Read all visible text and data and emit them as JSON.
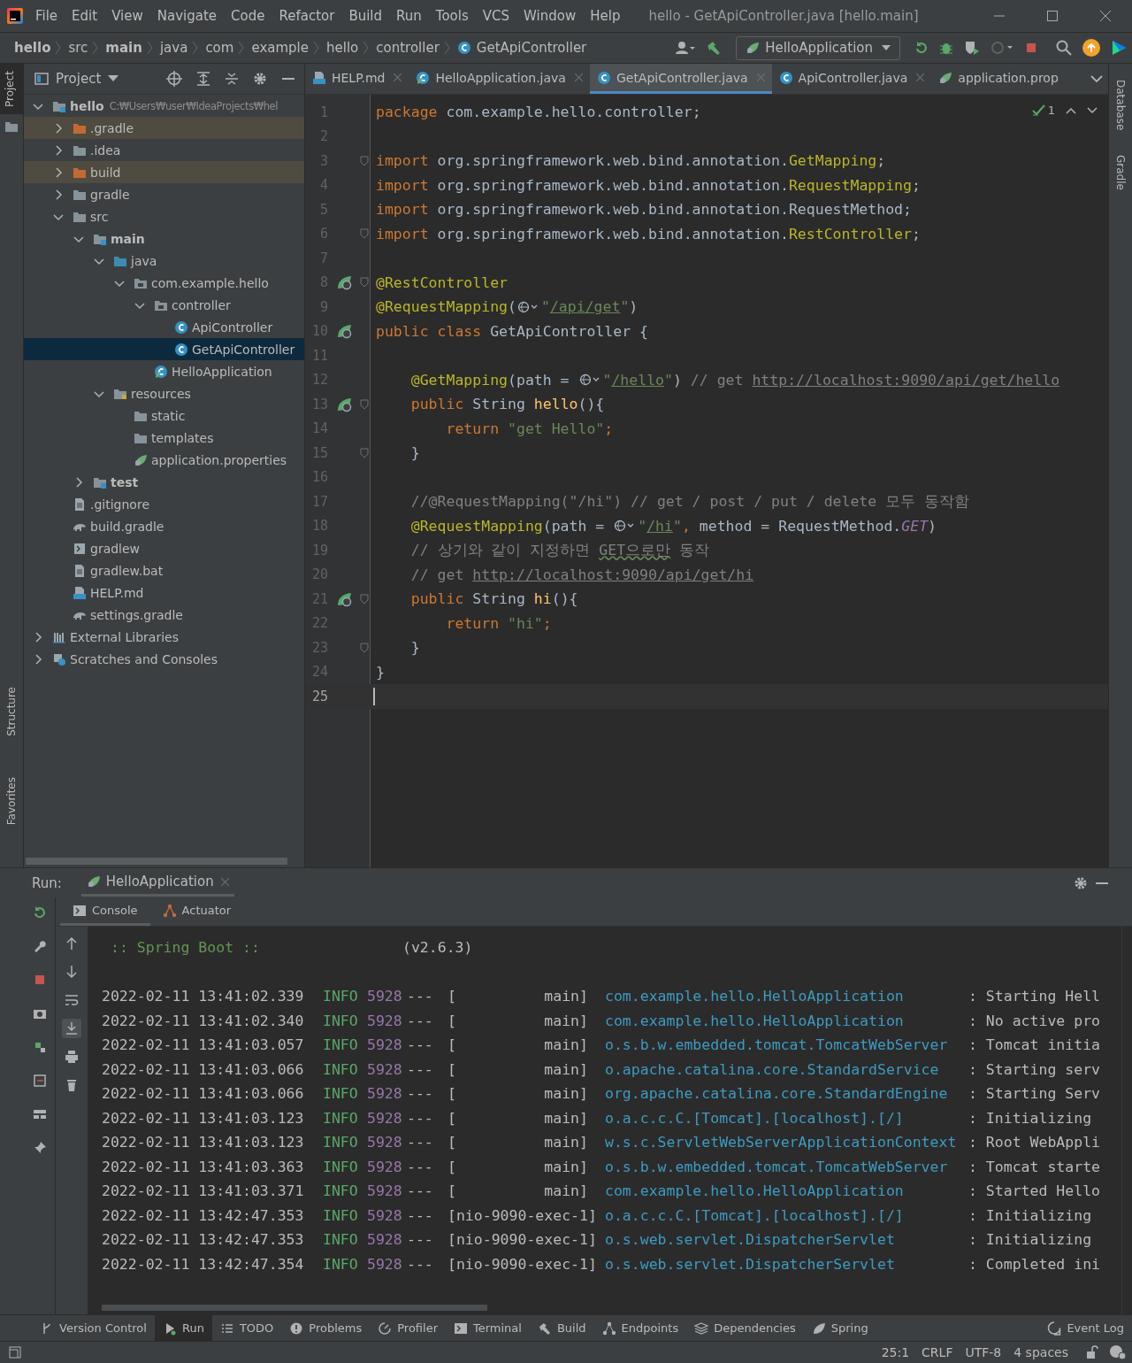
{
  "menu_bar": {
    "items": [
      "File",
      "Edit",
      "View",
      "Navigate",
      "Code",
      "Refactor",
      "Build",
      "Run",
      "Tools",
      "VCS",
      "Window",
      "Help"
    ],
    "title": "hello - GetApiController.java [hello.main]"
  },
  "breadcrumbs": [
    {
      "label": "hello",
      "kind": "bold"
    },
    {
      "label": "src",
      "kind": "plain"
    },
    {
      "label": "main",
      "kind": "bold"
    },
    {
      "label": "java",
      "kind": "plain"
    },
    {
      "label": "com",
      "kind": "plain"
    },
    {
      "label": "example",
      "kind": "plain"
    },
    {
      "label": "hello",
      "kind": "plain"
    },
    {
      "label": "controller",
      "kind": "plain"
    },
    {
      "label": "GetApiController",
      "kind": "class"
    }
  ],
  "run_config": "HelloApplication",
  "left_strip": {
    "top": "Project",
    "bottom": [
      "Structure",
      "Favorites"
    ]
  },
  "right_strip": [
    "Database",
    "Gradle"
  ],
  "project_panel": {
    "title": "Project",
    "tree": [
      {
        "label": "hello",
        "path": "C:₩Users₩user₩IdeaProjects₩hel",
        "kind": "module",
        "selected": false,
        "expanded": true,
        "children": [
          {
            "label": ".gradle",
            "kind": "excluded-folder",
            "selected": false,
            "expanded": false
          },
          {
            "label": ".idea",
            "kind": "folder",
            "selected": false,
            "expanded": false
          },
          {
            "label": "build",
            "kind": "excluded-folder",
            "selected": false,
            "expanded": false
          },
          {
            "label": "gradle",
            "kind": "folder",
            "selected": false,
            "expanded": false
          },
          {
            "label": "src",
            "kind": "folder",
            "selected": false,
            "expanded": true,
            "children": [
              {
                "label": "main",
                "kind": "source-root",
                "selected": false,
                "expanded": true,
                "children": [
                  {
                    "label": "java",
                    "kind": "java-root",
                    "selected": false,
                    "expanded": true,
                    "children": [
                      {
                        "label": "com.example.hello",
                        "kind": "package",
                        "selected": false,
                        "expanded": true,
                        "children": [
                          {
                            "label": "controller",
                            "kind": "package",
                            "selected": false,
                            "expanded": true,
                            "children": [
                              {
                                "label": "ApiController",
                                "kind": "class",
                                "selected": false
                              },
                              {
                                "label": "GetApiController",
                                "kind": "class",
                                "selected": true
                              }
                            ]
                          },
                          {
                            "label": "HelloApplication",
                            "kind": "spring-class",
                            "selected": false
                          }
                        ]
                      }
                    ]
                  },
                  {
                    "label": "resources",
                    "kind": "resources-folder",
                    "selected": false,
                    "expanded": true,
                    "children": [
                      {
                        "label": "static",
                        "kind": "folder",
                        "selected": false
                      },
                      {
                        "label": "templates",
                        "kind": "folder",
                        "selected": false
                      },
                      {
                        "label": "application.properties",
                        "kind": "spring-file",
                        "selected": false
                      }
                    ]
                  }
                ]
              },
              {
                "label": "test",
                "kind": "source-root",
                "selected": false,
                "expanded": false
              }
            ]
          },
          {
            "label": ".gitignore",
            "kind": "text-file",
            "selected": false
          },
          {
            "label": "build.gradle",
            "kind": "gradle-file",
            "selected": false
          },
          {
            "label": "gradlew",
            "kind": "script-file",
            "selected": false
          },
          {
            "label": "gradlew.bat",
            "kind": "text-file",
            "selected": false
          },
          {
            "label": "HELP.md",
            "kind": "md-file",
            "selected": false
          },
          {
            "label": "settings.gradle",
            "kind": "gradle-file",
            "selected": false
          }
        ]
      },
      {
        "label": "External Libraries",
        "kind": "libraries",
        "selected": false,
        "expanded": false
      },
      {
        "label": "Scratches and Consoles",
        "kind": "scratches",
        "selected": false,
        "expanded": false
      }
    ]
  },
  "editor_tabs": [
    {
      "label": "HELP.md",
      "kind": "md-file",
      "selected": false
    },
    {
      "label": "HelloApplication.java",
      "kind": "spring-class",
      "selected": false
    },
    {
      "label": "GetApiController.java",
      "kind": "class",
      "selected": true
    },
    {
      "label": "ApiController.java",
      "kind": "class",
      "selected": false
    },
    {
      "label": "application.prop",
      "kind": "spring-file",
      "selected": false
    }
  ],
  "inspection_count": "1",
  "code_lines": [
    {
      "number": "1",
      "current": false,
      "bean": false,
      "fold": false,
      "tokens": [
        {
          "kind": "keyword",
          "text": "package"
        },
        {
          "kind": "plain",
          "text": " com.example.hello.controller;"
        }
      ]
    },
    {
      "number": "2",
      "current": false,
      "bean": false,
      "fold": false
    },
    {
      "number": "3",
      "current": false,
      "bean": false,
      "fold": true,
      "tokens": [
        {
          "kind": "keyword",
          "text": "import"
        },
        {
          "kind": "plain",
          "text": " org.springframework.web.bind.annotation."
        },
        {
          "kind": "annotation",
          "text": "GetMapping"
        },
        {
          "kind": "plain",
          "text": ";"
        }
      ]
    },
    {
      "number": "4",
      "current": false,
      "bean": false,
      "fold": false,
      "tokens": [
        {
          "kind": "keyword",
          "text": "import"
        },
        {
          "kind": "plain",
          "text": " org.springframework.web.bind.annotation."
        },
        {
          "kind": "annotation",
          "text": "RequestMapping"
        },
        {
          "kind": "plain",
          "text": ";"
        }
      ]
    },
    {
      "number": "5",
      "current": false,
      "bean": false,
      "fold": false,
      "tokens": [
        {
          "kind": "keyword",
          "text": "import"
        },
        {
          "kind": "plain",
          "text": " org.springframework.web.bind.annotation.RequestMethod;"
        }
      ]
    },
    {
      "number": "6",
      "current": false,
      "bean": false,
      "fold": true,
      "tokens": [
        {
          "kind": "keyword",
          "text": "import"
        },
        {
          "kind": "plain",
          "text": " org.springframework.web.bind.annotation."
        },
        {
          "kind": "annotation",
          "text": "RestController"
        },
        {
          "kind": "plain",
          "text": ";"
        }
      ]
    },
    {
      "number": "7",
      "current": false,
      "bean": false,
      "fold": false
    },
    {
      "number": "8",
      "current": false,
      "bean": true,
      "fold": true,
      "tokens": [
        {
          "kind": "annotation",
          "text": "@RestController"
        }
      ]
    },
    {
      "number": "9",
      "current": false,
      "bean": false,
      "fold": false,
      "tokens": [
        {
          "kind": "annotation",
          "text": "@RequestMapping"
        },
        {
          "kind": "plain",
          "text": "("
        },
        {
          "kind": "globe"
        },
        {
          "kind": "string",
          "text": "\""
        },
        {
          "kind": "string-link",
          "text": "/api/get"
        },
        {
          "kind": "string",
          "text": "\""
        },
        {
          "kind": "plain",
          "text": ")"
        }
      ]
    },
    {
      "number": "10",
      "current": false,
      "bean": true,
      "fold": false,
      "tokens": [
        {
          "kind": "keyword",
          "text": "public class"
        },
        {
          "kind": "plain",
          "text": " GetApiController {"
        }
      ]
    },
    {
      "number": "11",
      "current": false,
      "bean": false,
      "fold": false
    },
    {
      "number": "12",
      "current": false,
      "bean": false,
      "fold": false,
      "tokens": [
        {
          "kind": "annotation",
          "text": "    @GetMapping"
        },
        {
          "kind": "plain",
          "text": "(path = "
        },
        {
          "kind": "globe"
        },
        {
          "kind": "string",
          "text": "\""
        },
        {
          "kind": "string-link",
          "text": "/hello"
        },
        {
          "kind": "string",
          "text": "\""
        },
        {
          "kind": "plain",
          "text": ") "
        },
        {
          "kind": "comment",
          "text": "// get "
        },
        {
          "kind": "comment-link",
          "text": "http://localhost:9090/api/get/hello"
        }
      ]
    },
    {
      "number": "13",
      "current": false,
      "bean": true,
      "fold": true,
      "tokens": [
        {
          "kind": "keyword",
          "text": "    public"
        },
        {
          "kind": "plain",
          "text": " String "
        },
        {
          "kind": "method",
          "text": "hello"
        },
        {
          "kind": "plain",
          "text": "(){"
        }
      ]
    },
    {
      "number": "14",
      "current": false,
      "bean": false,
      "fold": false,
      "tokens": [
        {
          "kind": "keyword",
          "text": "        return"
        },
        {
          "kind": "string",
          "text": " \"get Hello\""
        },
        {
          "kind": "keyword",
          "text": ";"
        }
      ]
    },
    {
      "number": "15",
      "current": false,
      "bean": false,
      "fold": true,
      "tokens": [
        {
          "kind": "plain",
          "text": "    }"
        }
      ]
    },
    {
      "number": "16",
      "current": false,
      "bean": false,
      "fold": false
    },
    {
      "number": "17",
      "current": false,
      "bean": false,
      "fold": false,
      "tokens": [
        {
          "kind": "comment",
          "text": "    //@RequestMapping(\"/hi\") // get / post / put / delete 모두 동작함"
        }
      ]
    },
    {
      "number": "18",
      "current": false,
      "bean": false,
      "fold": false,
      "tokens": [
        {
          "kind": "annotation",
          "text": "    @RequestMapping"
        },
        {
          "kind": "plain",
          "text": "(path = "
        },
        {
          "kind": "globe"
        },
        {
          "kind": "string",
          "text": "\""
        },
        {
          "kind": "string-link",
          "text": "/hi"
        },
        {
          "kind": "string",
          "text": "\""
        },
        {
          "kind": "keyword",
          "text": ","
        },
        {
          "kind": "plain",
          "text": " method = RequestMethod."
        },
        {
          "kind": "constant",
          "text": "GET"
        },
        {
          "kind": "plain",
          "text": ")"
        }
      ]
    },
    {
      "number": "19",
      "current": false,
      "bean": false,
      "fold": false,
      "tokens": [
        {
          "kind": "comment",
          "text": "    // 상기와 같이 지정하면 "
        },
        {
          "kind": "comment-typo",
          "text": "GET으로만"
        },
        {
          "kind": "comment",
          "text": " 동작"
        }
      ]
    },
    {
      "number": "20",
      "current": false,
      "bean": false,
      "fold": false,
      "tokens": [
        {
          "kind": "comment",
          "text": "    // get "
        },
        {
          "kind": "comment-link",
          "text": "http://localhost:9090/api/get/hi"
        }
      ]
    },
    {
      "number": "21",
      "current": false,
      "bean": true,
      "fold": true,
      "tokens": [
        {
          "kind": "keyword",
          "text": "    public"
        },
        {
          "kind": "plain",
          "text": " String "
        },
        {
          "kind": "method",
          "text": "hi"
        },
        {
          "kind": "plain",
          "text": "(){"
        }
      ]
    },
    {
      "number": "22",
      "current": false,
      "bean": false,
      "fold": false,
      "tokens": [
        {
          "kind": "keyword",
          "text": "        return"
        },
        {
          "kind": "string",
          "text": " \"hi\""
        },
        {
          "kind": "keyword",
          "text": ";"
        }
      ]
    },
    {
      "number": "23",
      "current": false,
      "bean": false,
      "fold": true,
      "tokens": [
        {
          "kind": "plain",
          "text": "    }"
        }
      ]
    },
    {
      "number": "24",
      "current": false,
      "bean": false,
      "fold": false,
      "tokens": [
        {
          "kind": "plain",
          "text": "}"
        }
      ]
    },
    {
      "number": "25",
      "current": true,
      "bean": false,
      "fold": false
    }
  ],
  "run_panel": {
    "label": "Run:",
    "tab": "HelloApplication",
    "subtabs": [
      {
        "label": "Console",
        "kind": "console",
        "selected": true
      },
      {
        "label": "Actuator",
        "kind": "actuator",
        "selected": false
      }
    ],
    "banner": {
      "name": ":: Spring Boot ::",
      "version": "(v2.6.3)"
    },
    "log": [
      {
        "time": "2022-02-11 13:41:02.339",
        "level": "INFO",
        "pid": "5928",
        "sep": "---",
        "thread": "[          main]",
        "logger": "com.example.hello.HelloApplication",
        "message": ": Starting Hell"
      },
      {
        "time": "2022-02-11 13:41:02.340",
        "level": "INFO",
        "pid": "5928",
        "sep": "---",
        "thread": "[          main]",
        "logger": "com.example.hello.HelloApplication",
        "message": ": No active pro"
      },
      {
        "time": "2022-02-11 13:41:03.057",
        "level": "INFO",
        "pid": "5928",
        "sep": "---",
        "thread": "[          main]",
        "logger": "o.s.b.w.embedded.tomcat.TomcatWebServer",
        "message": ": Tomcat initia"
      },
      {
        "time": "2022-02-11 13:41:03.066",
        "level": "INFO",
        "pid": "5928",
        "sep": "---",
        "thread": "[          main]",
        "logger": "o.apache.catalina.core.StandardService",
        "message": ": Starting serv"
      },
      {
        "time": "2022-02-11 13:41:03.066",
        "level": "INFO",
        "pid": "5928",
        "sep": "---",
        "thread": "[          main]",
        "logger": "org.apache.catalina.core.StandardEngine",
        "message": ": Starting Serv"
      },
      {
        "time": "2022-02-11 13:41:03.123",
        "level": "INFO",
        "pid": "5928",
        "sep": "---",
        "thread": "[          main]",
        "logger": "o.a.c.c.C.[Tomcat].[localhost].[/]",
        "message": ": Initializing"
      },
      {
        "time": "2022-02-11 13:41:03.123",
        "level": "INFO",
        "pid": "5928",
        "sep": "---",
        "thread": "[          main]",
        "logger": "w.s.c.ServletWebServerApplicationContext",
        "message": ": Root WebAppli"
      },
      {
        "time": "2022-02-11 13:41:03.363",
        "level": "INFO",
        "pid": "5928",
        "sep": "---",
        "thread": "[          main]",
        "logger": "o.s.b.w.embedded.tomcat.TomcatWebServer",
        "message": ": Tomcat starte"
      },
      {
        "time": "2022-02-11 13:41:03.371",
        "level": "INFO",
        "pid": "5928",
        "sep": "---",
        "thread": "[          main]",
        "logger": "com.example.hello.HelloApplication",
        "message": ": Started Hello"
      },
      {
        "time": "2022-02-11 13:42:47.353",
        "level": "INFO",
        "pid": "5928",
        "sep": "---",
        "thread": "[nio-9090-exec-1]",
        "logger": "o.a.c.c.C.[Tomcat].[localhost].[/]",
        "message": ": Initializing"
      },
      {
        "time": "2022-02-11 13:42:47.353",
        "level": "INFO",
        "pid": "5928",
        "sep": "---",
        "thread": "[nio-9090-exec-1]",
        "logger": "o.s.web.servlet.DispatcherServlet",
        "message": ": Initializing"
      },
      {
        "time": "2022-02-11 13:42:47.354",
        "level": "INFO",
        "pid": "5928",
        "sep": "---",
        "thread": "[nio-9090-exec-1]",
        "logger": "o.s.web.servlet.DispatcherServlet",
        "message": ": Completed ini"
      }
    ]
  },
  "tool_tabs": [
    {
      "label": "Version Control",
      "kind": "vcs",
      "selected": false
    },
    {
      "label": "Run",
      "kind": "run",
      "selected": true
    },
    {
      "label": "TODO",
      "kind": "todo",
      "selected": false
    },
    {
      "label": "Problems",
      "kind": "problems",
      "selected": false
    },
    {
      "label": "Profiler",
      "kind": "profiler",
      "selected": false
    },
    {
      "label": "Terminal",
      "kind": "terminal",
      "selected": false
    },
    {
      "label": "Build",
      "kind": "build",
      "selected": false
    },
    {
      "label": "Endpoints",
      "kind": "endpoints",
      "selected": false
    },
    {
      "label": "Dependencies",
      "kind": "dependencies",
      "selected": false
    },
    {
      "label": "Spring",
      "kind": "spring",
      "selected": false
    }
  ],
  "event_log": "Event Log",
  "status_bar": [
    "25:1",
    "CRLF",
    "UTF-8",
    "4 spaces"
  ]
}
